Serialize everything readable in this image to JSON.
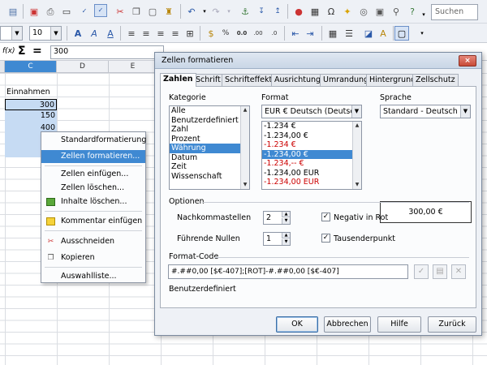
{
  "toolbar": {
    "search_placeholder": "Suchen"
  },
  "format_bar": {
    "font_size": "10"
  },
  "formula_bar": {
    "fx": "f(x)",
    "sum": "Σ",
    "equals": "=",
    "value": "300"
  },
  "columns": {
    "c": "C",
    "d": "D",
    "e": "E"
  },
  "sheet": {
    "header_cell": "Einnahmen",
    "values": [
      "300",
      "150",
      "400"
    ]
  },
  "context_menu": {
    "items": [
      "Standardformatierung",
      "Zellen formatieren...",
      "Zellen einfügen...",
      "Zellen löschen...",
      "Inhalte löschen...",
      "Kommentar einfügen",
      "Ausschneiden",
      "Kopieren",
      "Auswahlliste..."
    ]
  },
  "dialog": {
    "title": "Zellen formatieren",
    "close": "×",
    "tabs": [
      "Zahlen",
      "Schrift",
      "Schrifteffekt",
      "Ausrichtung",
      "Umrandung",
      "Hintergrund",
      "Zellschutz"
    ],
    "category_label": "Kategorie",
    "categories": [
      "Alle",
      "Benutzerdefiniert",
      "Zahl",
      "Prozent",
      "Währung",
      "Datum",
      "Zeit",
      "Wissenschaft"
    ],
    "format_label": "Format",
    "format_dropdown": "EUR € Deutsch (Deutschland)",
    "formats": [
      "-1.234 €",
      "-1.234,00 €",
      "-1.234 €",
      "-1.234,00 €",
      "-1.234,-- €",
      "-1.234,00 EUR",
      "-1.234,00 EUR"
    ],
    "language_label": "Sprache",
    "language_dropdown": "Standard - Deutsch (Deutschland)",
    "preview": "300,00 €",
    "options_label": "Optionen",
    "decimals_label": "Nachkommastellen",
    "decimals_value": "2",
    "leading_zeros_label": "Führende Nullen",
    "leading_zeros_value": "1",
    "negative_red_label": "Negativ in Rot",
    "thousands_label": "Tausenderpunkt",
    "format_code_label": "Format-Code",
    "format_code": "#.##0,00 [$€-407];[ROT]-#.##0,00 [$€-407]",
    "user_defined": "Benutzerdefiniert",
    "buttons": {
      "ok": "OK",
      "cancel": "Abbrechen",
      "help": "Hilfe",
      "back": "Zurück"
    }
  },
  "colors": {
    "selection": "#3f89d2",
    "negative": "#cc0000",
    "close": "#c84b37"
  }
}
